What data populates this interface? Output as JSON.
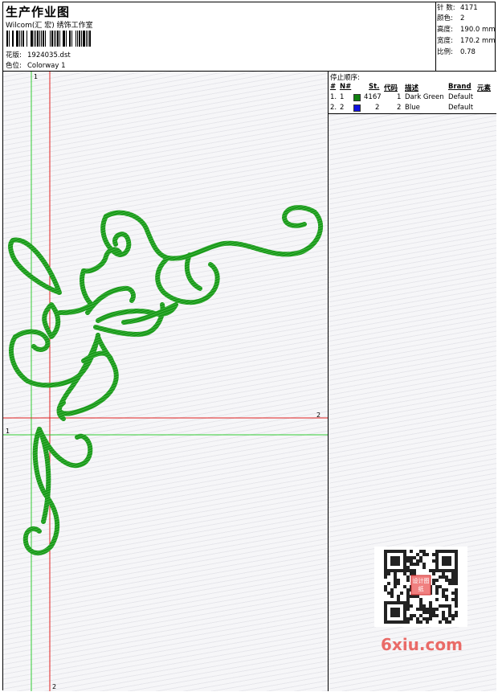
{
  "header": {
    "title": "生产作业图",
    "subtitle": "Wilcom(汇 宏) 绣饰工作室",
    "design_label": "花版:",
    "design_value": "1924035.dst",
    "colorway_label": "色位:",
    "colorway_value": "Colorway 1"
  },
  "stats": [
    {
      "key": "针 数:",
      "value": "4171"
    },
    {
      "key": "颜色:",
      "value": "2"
    },
    {
      "key": "高度:",
      "value": "190.0 mm"
    },
    {
      "key": "宽度:",
      "value": "170.2 mm"
    },
    {
      "key": "比例:",
      "value": "0.78"
    }
  ],
  "stop_sequence": {
    "title": "停止顺序:",
    "columns": [
      "#",
      "N#",
      "St.",
      "代码",
      "描述",
      "Brand",
      "元素"
    ],
    "rows": [
      {
        "index": "1.",
        "n": "1",
        "color": "#108010",
        "stitches": "4167",
        "code": "1",
        "description": "Dark Green",
        "brand": "Default"
      },
      {
        "index": "2.",
        "n": "2",
        "color": "#1010e0",
        "stitches": "2",
        "code": "2",
        "description": "Blue",
        "brand": "Default"
      }
    ]
  },
  "guides": {
    "v1_top": "1",
    "h1_left": "1",
    "h2_right": "2",
    "v2_bottom": "2"
  },
  "colors": {
    "stitch_green": "#1a9a1a",
    "guide_green": "#33cc33",
    "guide_red": "#e02020",
    "watermark": "#e8534f"
  },
  "watermark": {
    "text": "6xiu.com",
    "qr_stamp": "设计图纸"
  }
}
